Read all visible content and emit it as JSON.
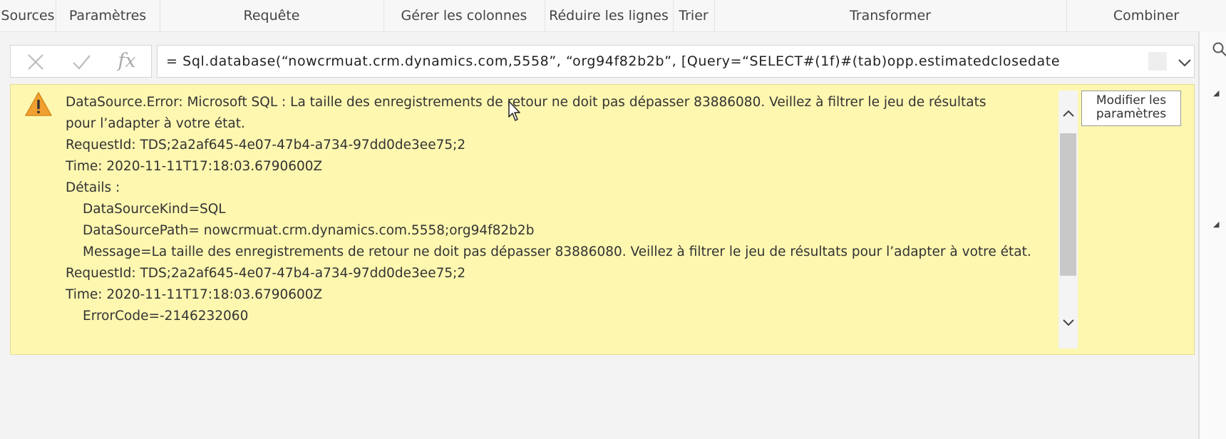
{
  "ribbon": {
    "groups": [
      "Sources",
      "Paramètres",
      "Requête",
      "Gérer les colonnes",
      "Réduire les lignes",
      "Trier",
      "Transformer",
      "Combiner"
    ]
  },
  "formula_bar": {
    "cancel_icon": "close-icon",
    "confirm_icon": "check-icon",
    "fx_label": "fx",
    "formula": "=  Sql.database(“nowcrmuat.crm.dynamics.com,5558”, “org94f82b2b”, [Query=“SELECT#(1f)#(tab)opp.estimatedclosedate"
  },
  "error": {
    "icon": "warning-icon",
    "lines": [
      "DataSource.Error: Microsoft SQL : La taille des enregistrements de retour ne doit pas dépasser 83886080. Veillez à filtrer le jeu de résultats",
      "pour l’adapter à votre état.",
      "RequestId: TDS;2a2af645-4e07-47b4-a734-97dd0de3ee75;2",
      "Time: 2020-11-11T17:18:03.6790600Z",
      "Détails :",
      "DataSourceKind=SQL",
      "DataSourcePath= nowcrmuat.crm.dynamics.com.5558;org94f82b2b",
      "Message=La taille des enregistrements de retour ne doit pas dépasser 83886080. Veillez à filtrer le jeu de résultats pour l’adapter à votre état.",
      "RequestId: TDS;2a2af645-4e07-47b4-a734-97dd0de3ee75;2",
      "Time: 2020-11-11T17:18:03.6790600Z",
      "ErrorCode=-2146232060"
    ],
    "modify_button": [
      "Modifier les",
      "paramètres"
    ]
  },
  "colors": {
    "error_background": "#fdf7b0",
    "warning_icon": "#f0a030"
  }
}
